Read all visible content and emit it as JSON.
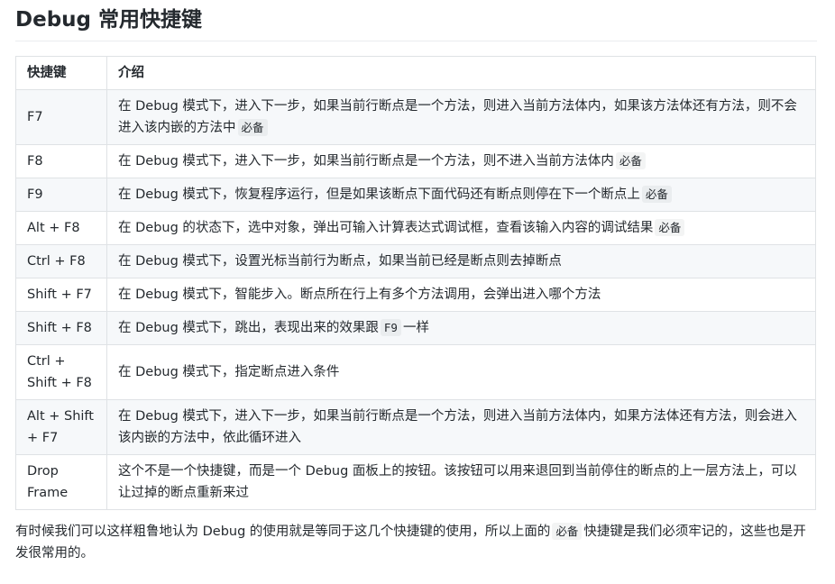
{
  "title": "Debug 常用快捷键",
  "table": {
    "headers": [
      "快捷键",
      "介绍"
    ],
    "rows": [
      {
        "key": "F7",
        "desc": "在 Debug 模式下，进入下一步，如果当前行断点是一个方法，则进入当前方法体内，如果该方法体还有方法，则不会进入该内嵌的方法中",
        "code": "必备",
        "after": ""
      },
      {
        "key": "F8",
        "desc": "在 Debug 模式下，进入下一步，如果当前行断点是一个方法，则不进入当前方法体内",
        "code": "必备",
        "after": ""
      },
      {
        "key": "F9",
        "desc": "在 Debug 模式下，恢复程序运行，但是如果该断点下面代码还有断点则停在下一个断点上",
        "code": "必备",
        "after": ""
      },
      {
        "key": "Alt + F8",
        "desc": "在 Debug 的状态下，选中对象，弹出可输入计算表达式调试框，查看该输入内容的调试结果",
        "code": "必备",
        "after": ""
      },
      {
        "key": "Ctrl + F8",
        "desc": "在 Debug 模式下，设置光标当前行为断点，如果当前已经是断点则去掉断点",
        "code": "",
        "after": ""
      },
      {
        "key": "Shift + F7",
        "desc": "在 Debug 模式下，智能步入。断点所在行上有多个方法调用，会弹出进入哪个方法",
        "code": "",
        "after": ""
      },
      {
        "key": "Shift + F8",
        "desc": "在 Debug 模式下，跳出，表现出来的效果跟",
        "code": "F9",
        "after": "一样"
      },
      {
        "key": "Ctrl + Shift + F8",
        "desc": "在 Debug 模式下，指定断点进入条件",
        "code": "",
        "after": ""
      },
      {
        "key": "Alt + Shift + F7",
        "desc": "在 Debug 模式下，进入下一步，如果当前行断点是一个方法，则进入当前方法体内，如果方法体还有方法，则会进入该内嵌的方法中，依此循环进入",
        "code": "",
        "after": ""
      },
      {
        "key": "Drop Frame",
        "desc": "这个不是一个快捷键，而是一个 Debug 面板上的按钮。该按钮可以用来退回到当前停住的断点的上一层方法上，可以让过掉的断点重新来过",
        "code": "",
        "after": ""
      }
    ]
  },
  "note": {
    "before": "有时候我们可以这样粗鲁地认为 Debug 的使用就是等同于这几个快捷键的使用，所以上面的",
    "code": "必备",
    "after": "快捷键是我们必须牢记的，这些也是开发很常用的。"
  }
}
